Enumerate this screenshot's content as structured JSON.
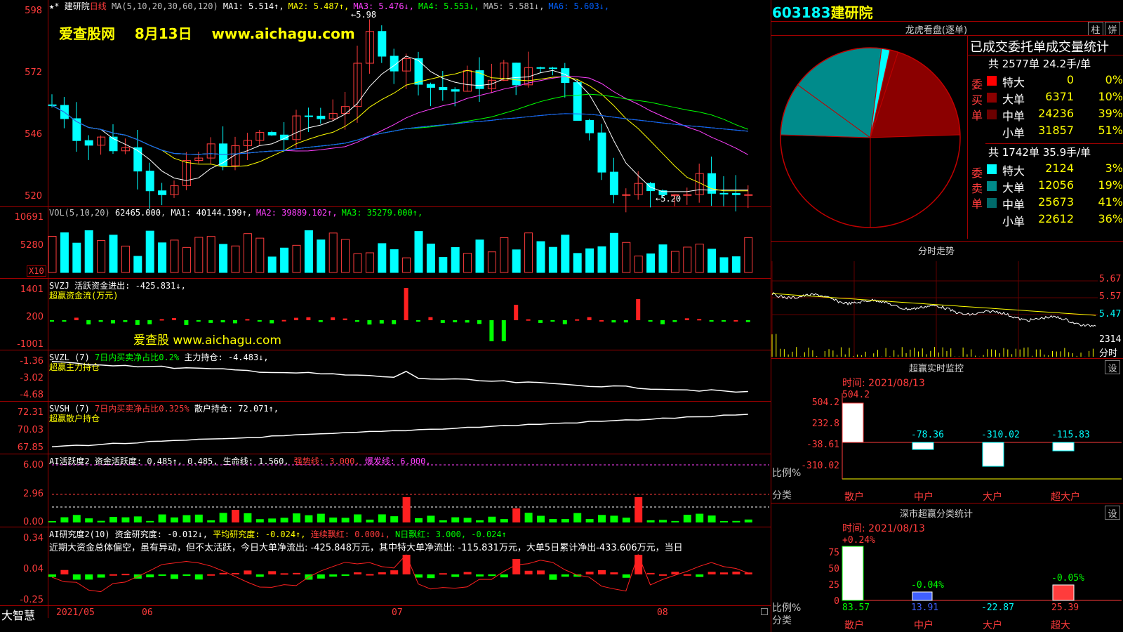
{
  "main": {
    "stock_name": "建研院",
    "period": "日线",
    "ma_header": "MA(5,10,20,30,60,120)",
    "ma_values": [
      {
        "label": "MA1:",
        "value": "5.514",
        "arrow": "↑",
        "color": "#ffffff"
      },
      {
        "label": "MA2:",
        "value": "5.487",
        "arrow": "↑",
        "color": "#ffff00"
      },
      {
        "label": "MA3:",
        "value": "5.476",
        "arrow": "↓",
        "color": "#ff40ff"
      },
      {
        "label": "MA4:",
        "value": "5.553",
        "arrow": "↓",
        "color": "#00ff00"
      },
      {
        "label": "MA5:",
        "value": "5.581",
        "arrow": "↓",
        "color": "#c0c0c0"
      },
      {
        "label": "MA6:",
        "value": "5.603",
        "arrow": "↓",
        "color": "#0060ff"
      }
    ],
    "high_marker": "5.98",
    "low_marker": "←5.20",
    "watermark": "爱查股网    8月13日    www.aichagu.com",
    "price_ticks": [
      "598",
      "572",
      "546",
      "520"
    ]
  },
  "vol": {
    "header": "VOL(5,10,20)",
    "value": "62465.000",
    "ma_values": [
      {
        "label": "MA1:",
        "value": "40144.199",
        "arrow": "↑",
        "color": "#ffffff"
      },
      {
        "label": "MA2:",
        "value": "39889.102",
        "arrow": "↑",
        "color": "#ff40ff"
      },
      {
        "label": "MA3:",
        "value": "35279.000",
        "arrow": "↑",
        "color": "#00ff00"
      }
    ],
    "ticks": [
      "10691",
      "5280"
    ],
    "unit": "X10"
  },
  "svzj": {
    "header": "SVZJ  活跃资金进出: -425.831↓,",
    "subtitle": "超赢资金流(万元)",
    "watermark": "爱查股 www.aichagu.com",
    "ticks": [
      "1401",
      "200",
      "-1001"
    ]
  },
  "svzl": {
    "header_a": "SVZL (7)",
    "header_b": "7日内买卖净占比0.2%",
    "header_c": "主力持仓: -4.483↓,",
    "subtitle": "超赢主力持仓",
    "ticks": [
      "-1.36",
      "-3.02",
      "-4.68"
    ]
  },
  "svsh": {
    "header_a": "SVSH (7)",
    "header_b": "7日内买卖净占比0.325%",
    "header_c": "散户持仓: 72.071↑,",
    "subtitle": "超赢散户持仓",
    "ticks": [
      "72.31",
      "70.03",
      "67.85"
    ]
  },
  "ai1": {
    "header_a": "AI活跃度2 资金活跃度: 0.485↑, 0.485, 生命线: 1.560,",
    "header_b": "强势线: 3.000,",
    "header_c": "爆发线: 6.000,",
    "ticks": [
      "6.00",
      "2.96",
      "0.00"
    ]
  },
  "ai2": {
    "header_a": "AI研究度2(10) 资金研究度: -0.012↓,",
    "header_b": "平均研究度: -0.024↑,",
    "header_c": "连续飘红: 0.000↓,",
    "header_d": "N日飘红: 3.000, -0.024↑",
    "comment": "近期大资金总体偏空，虽有异动，但不太活跃，今日大单净流出: -425.848万元，其中特大单净流出: -115.831万元，大单5日累计净出-433.606万元，当日",
    "ticks": [
      "0.34",
      "0.04",
      "-0.25"
    ]
  },
  "bottom": {
    "app_name": "大智慧",
    "dates": [
      "2021/05",
      "06",
      "07",
      "08"
    ]
  },
  "right": {
    "code": "603183",
    "name": "建研院",
    "lhb_title": "龙虎看盘(逐单)",
    "btn_zhu": "柱",
    "btn_bing": "饼",
    "stats_title": "已成交委托单成交量统计",
    "buy_total": "共 2577单 24.2手/单",
    "buy_side": "委买单",
    "sell_total": "共 1742单 35.9手/单",
    "sell_side": "委卖单",
    "buy_rows": [
      {
        "label": "特大",
        "value": "0",
        "pct": "0%",
        "color": "#ff0000"
      },
      {
        "label": "大单",
        "value": "6371",
        "pct": "10%",
        "color": "#8b0000"
      },
      {
        "label": "中单",
        "value": "24236",
        "pct": "39%",
        "color": "#6b0000"
      },
      {
        "label": "小单",
        "value": "31857",
        "pct": "51%",
        "color": "#000000"
      }
    ],
    "sell_rows": [
      {
        "label": "特大",
        "value": "2124",
        "pct": "3%",
        "color": "#00ffff"
      },
      {
        "label": "大单",
        "value": "12056",
        "pct": "19%",
        "color": "#008b8b"
      },
      {
        "label": "中单",
        "value": "25673",
        "pct": "41%",
        "color": "#006b6b"
      },
      {
        "label": "小单",
        "value": "22612",
        "pct": "36%",
        "color": "#000000"
      }
    ],
    "fs_title": "分时走势",
    "fs_ticks": [
      "5.67",
      "5.57",
      "5.47"
    ],
    "fs_vol": "2314",
    "fs_unit": "分时",
    "monitor_title": "超赢实时监控",
    "monitor_btn": "设",
    "monitor_time": "时间: 2021/08/13",
    "monitor_ticks": [
      "504.2",
      "232.8",
      "-38.61",
      "-310.02"
    ],
    "monitor_vals": [
      "504.2",
      "-78.36",
      "-310.02",
      "-115.83"
    ],
    "monitor_cats": [
      "散户",
      "中户",
      "大户",
      "超大户"
    ],
    "ratio_label": "比例%",
    "cat_label": "分类",
    "sz_title": "深市超赢分类统计",
    "sz_btn": "设",
    "sz_time": "时间: 2021/08/13",
    "sz_ticks": [
      "75",
      "50",
      "25",
      "0"
    ],
    "sz_top_vals": [
      "+0.24%",
      "-0.04%",
      "-0.05%"
    ],
    "sz_bottom_vals": [
      "83.57",
      "13.91",
      "-22.87",
      "25.39"
    ],
    "sz_cats": [
      "散户",
      "中户",
      "大户",
      "超大"
    ]
  }
}
